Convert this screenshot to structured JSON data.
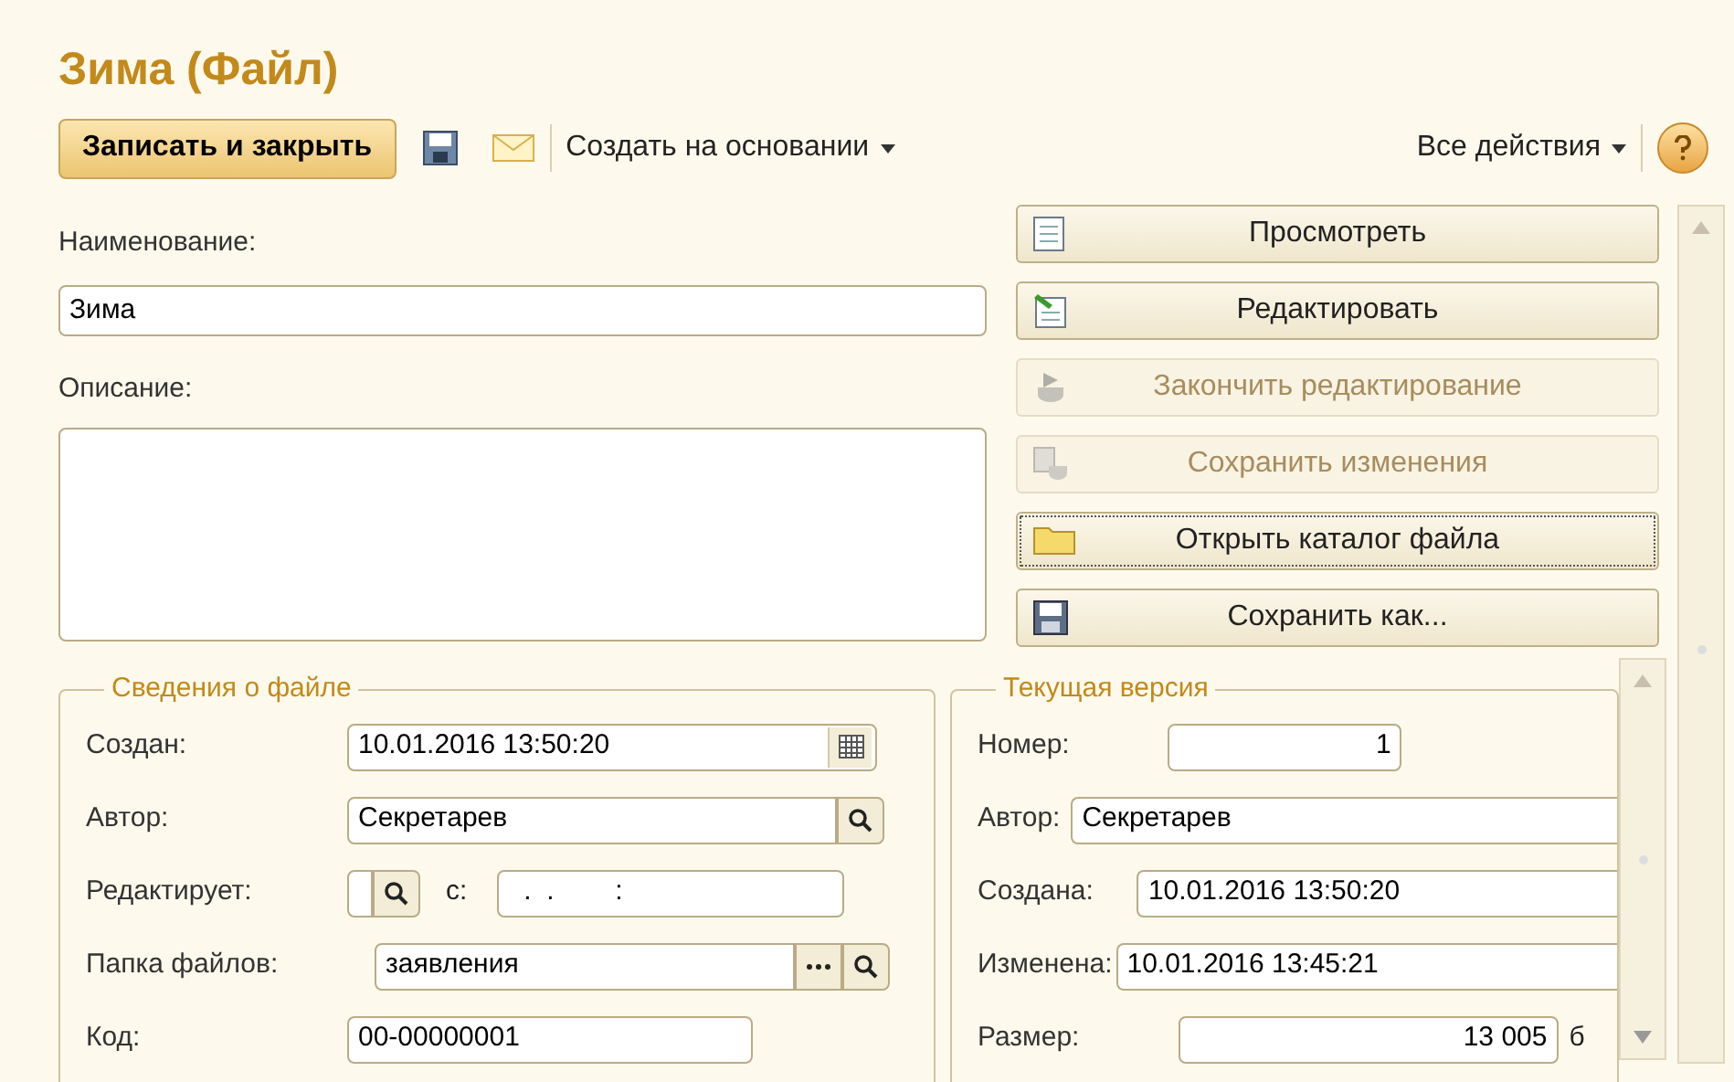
{
  "window": {
    "title": "Зима (Файл)"
  },
  "toolbar": {
    "primary_button": "Записать и закрыть",
    "menus": [
      "Создать на основании",
      "Все действия"
    ]
  },
  "form": {
    "name": {
      "label": "Наименование:",
      "value": "Зима"
    },
    "description": {
      "label": "Описание:"
    }
  },
  "actions": [
    {
      "label": "Просмотреть",
      "kind": "view",
      "disabled": false,
      "focused": false
    },
    {
      "label": "Редактировать",
      "kind": "edit",
      "disabled": false,
      "focused": false
    },
    {
      "label": "Закончить редактирование",
      "kind": "finish",
      "disabled": true,
      "focused": false
    },
    {
      "label": "Сохранить изменения",
      "kind": "save-changes",
      "disabled": true,
      "focused": false
    },
    {
      "label": "Открыть каталог файла",
      "kind": "folder",
      "disabled": false,
      "focused": true
    },
    {
      "label": "Сохранить как...",
      "kind": "save-as",
      "disabled": false,
      "focused": false
    }
  ],
  "file_info": {
    "title": "Сведения о файле",
    "rows": [
      {
        "label": "Создан:",
        "kind": "date",
        "value": "10.01.2016 13:50:20"
      },
      {
        "label": "Автор:",
        "kind": "lookup",
        "value": "Секретарев"
      },
      {
        "label": "Редактирует:",
        "kind": "editor",
        "since_label": "с:",
        "since_value": ".  .        :"
      },
      {
        "label": "Папка файлов:",
        "kind": "folder",
        "value": "заявления"
      },
      {
        "label": "Код:",
        "kind": "plain",
        "value": "00-00000001"
      }
    ]
  },
  "current_version": {
    "title": "Текущая версия",
    "rows": [
      {
        "label": "Номер:",
        "kind": "number",
        "value": "1"
      },
      {
        "label": "Автор:",
        "kind": "wide",
        "value": "Секретарев"
      },
      {
        "label": "Создана:",
        "kind": "field",
        "value": "10.01.2016 13:50:20"
      },
      {
        "label": "Изменена:",
        "kind": "field",
        "value": "10.01.2016 13:45:21"
      },
      {
        "label": "Размер:",
        "kind": "size",
        "value": "13 005",
        "unit": "б"
      }
    ]
  }
}
